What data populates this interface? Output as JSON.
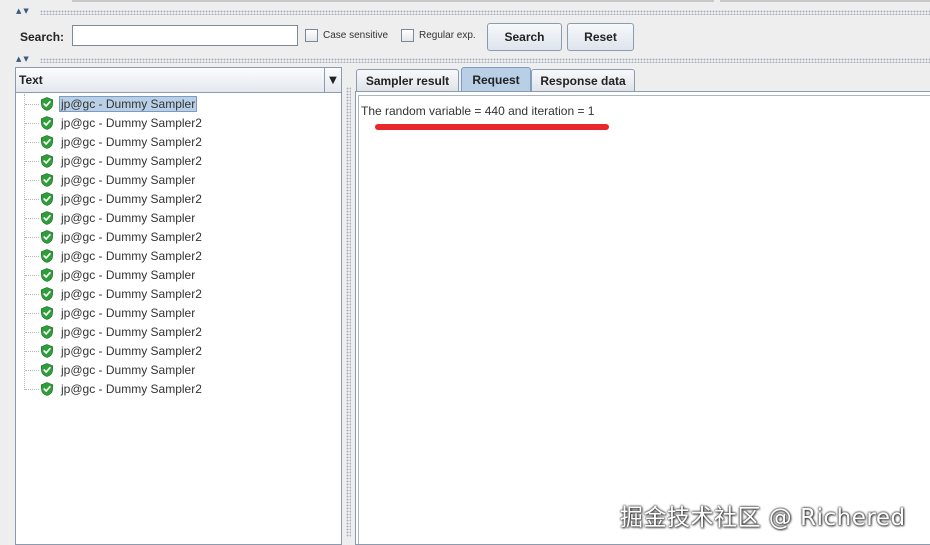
{
  "search": {
    "label": "Search:",
    "value": "",
    "placeholder": "",
    "case_sensitive_label": "Case sensitive",
    "regular_exp_label": "Regular exp.",
    "search_button": "Search",
    "reset_button": "Reset"
  },
  "results_tree": {
    "renderer_label": "Text",
    "items": [
      {
        "label": "jp@gc - Dummy Sampler",
        "selected": true
      },
      {
        "label": "jp@gc - Dummy Sampler2"
      },
      {
        "label": "jp@gc - Dummy Sampler2"
      },
      {
        "label": "jp@gc - Dummy Sampler2"
      },
      {
        "label": "jp@gc - Dummy Sampler"
      },
      {
        "label": "jp@gc - Dummy Sampler2"
      },
      {
        "label": "jp@gc - Dummy Sampler"
      },
      {
        "label": "jp@gc - Dummy Sampler2"
      },
      {
        "label": "jp@gc - Dummy Sampler2"
      },
      {
        "label": "jp@gc - Dummy Sampler"
      },
      {
        "label": "jp@gc - Dummy Sampler2"
      },
      {
        "label": "jp@gc - Dummy Sampler"
      },
      {
        "label": "jp@gc - Dummy Sampler2"
      },
      {
        "label": "jp@gc - Dummy Sampler2"
      },
      {
        "label": "jp@gc - Dummy Sampler"
      },
      {
        "label": "jp@gc - Dummy Sampler2"
      }
    ]
  },
  "tabs": {
    "sampler_result": "Sampler result",
    "request": "Request",
    "response_data": "Response data",
    "active": "request"
  },
  "request": {
    "text": "The random variable = 440 and iteration = 1"
  },
  "watermark": "掘金技术社区 @ Richered",
  "colors": {
    "selection": "#b8cfe5",
    "success_icon": "#2e9e3a",
    "annotation_mark": "#e8282b"
  }
}
